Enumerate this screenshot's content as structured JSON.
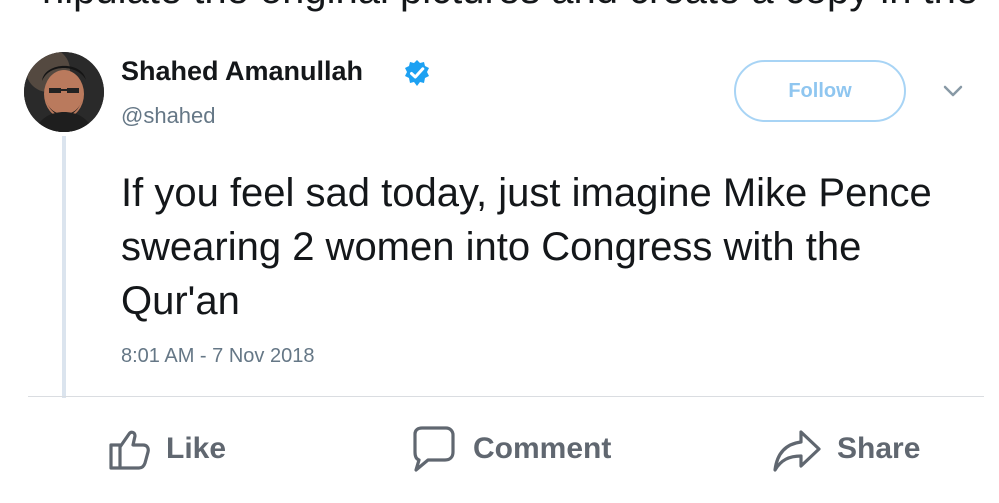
{
  "top_crop_text": "nipulate the original pictures and create a copy in the",
  "tweet": {
    "author_name": "Shahed Amanullah",
    "handle": "@shahed",
    "follow_label": "Follow",
    "text": "If you feel sad today, just imagine Mike Pence swearing 2 women into Congress with the Qur'an",
    "timestamp": "8:01 AM - 7 Nov 2018",
    "verified_color": "#1da1f2"
  },
  "actions": {
    "like_label": "Like",
    "comment_label": "Comment",
    "share_label": "Share"
  },
  "icons": [
    "thumbs-up-icon",
    "comment-icon",
    "share-arrow-icon",
    "verified-badge-icon",
    "chevron-down-icon"
  ]
}
